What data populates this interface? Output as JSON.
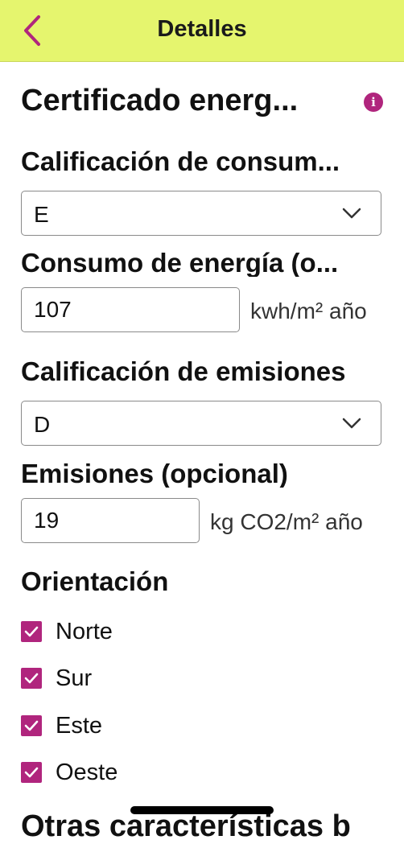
{
  "header": {
    "title": "Detalles",
    "back_icon": "chevron-left-icon"
  },
  "section": {
    "title": "Certificado energ...",
    "info_icon": "i"
  },
  "consumption_rating": {
    "label": "Calificación de consum...",
    "value": "E"
  },
  "energy_consumption": {
    "label": "Consumo de energía (o...",
    "value": "107",
    "unit": "kwh/m² año"
  },
  "emissions_rating": {
    "label": "Calificación de emisiones",
    "value": "D"
  },
  "emissions": {
    "label": "Emisiones (opcional)",
    "value": "19",
    "unit": "kg CO2/m² año"
  },
  "orientation": {
    "label": "Orientación",
    "options": [
      {
        "label": "Norte",
        "checked": true
      },
      {
        "label": "Sur",
        "checked": true
      },
      {
        "label": "Este",
        "checked": true
      },
      {
        "label": "Oeste",
        "checked": true
      }
    ]
  },
  "next_section": {
    "title": "Otras características b"
  },
  "colors": {
    "header_bg": "#e5f56e",
    "accent": "#b0257d"
  }
}
